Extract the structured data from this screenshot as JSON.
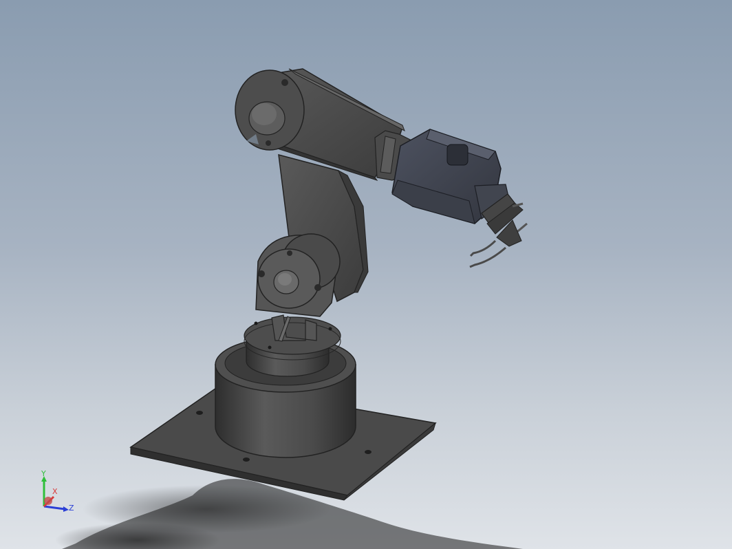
{
  "viewport": {
    "background_top": "#8a9cb0",
    "background_bottom": "#dfe3e8"
  },
  "triad": {
    "y_label": "Y",
    "x_label": "X",
    "z_label": "Z",
    "y_color": "#2fbf3a",
    "x_color": "#d83a3a",
    "z_color": "#2b3fd6"
  }
}
